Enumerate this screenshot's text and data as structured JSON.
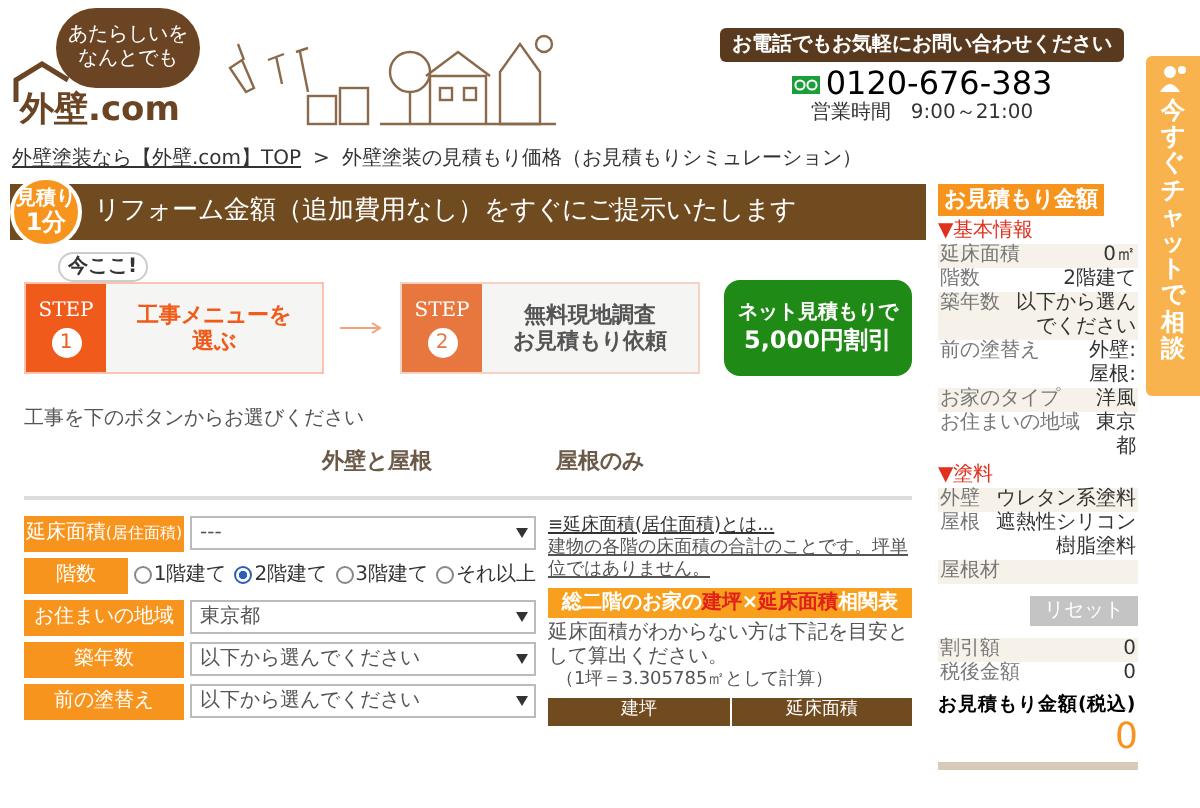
{
  "header": {
    "logo_bubble": [
      "あたらしいを",
      "なんとでも"
    ],
    "logo_text": "外壁.com",
    "contact_tagline": "お電話でもお気軽にお問い合わせください",
    "phone": "0120-676-383",
    "hours": "営業時間　9:00～21:00"
  },
  "chat_tab": {
    "label": "今すぐチャットで相談"
  },
  "breadcrumb": [
    {
      "label": "外壁塗装なら【外壁.com】TOP",
      "kind": "link"
    },
    {
      "label": ">",
      "kind": "separator"
    },
    {
      "label": "外壁塗装の見積もり価格（お見積もりシミュレーション）",
      "kind": "current"
    }
  ],
  "banner": {
    "badge": [
      "見積り",
      "1分"
    ],
    "title": "リフォーム金額（追加費用なし）をすぐにご提示いたします"
  },
  "steps": [
    {
      "step": "STEP",
      "number": "1",
      "lines": [
        "工事メニューを",
        "選ぶ"
      ],
      "selected": true,
      "bubble": "今ここ!"
    },
    {
      "step": "STEP",
      "number": "2",
      "lines": [
        "無料現地調査",
        "お見積もり依頼"
      ],
      "selected": false
    }
  ],
  "promo": [
    "ネット見積もりで",
    "5,000円割引"
  ],
  "instruction": "工事を下のボタンからお選びください",
  "choices": [
    "外壁と屋根",
    "屋根のみ"
  ],
  "form": [
    {
      "label": "延床面積",
      "sub": "(居住面積)",
      "kind": "select",
      "value": "---"
    },
    {
      "label": "階数",
      "kind": "radio",
      "options": [
        {
          "label": "1階建て",
          "selected": false
        },
        {
          "label": "2階建て",
          "selected": true
        },
        {
          "label": "3階建て",
          "selected": false
        },
        {
          "label": "それ以上",
          "selected": false
        }
      ]
    },
    {
      "label": "お住まいの地域",
      "kind": "select",
      "value": "東京都"
    },
    {
      "label": "築年数",
      "kind": "select",
      "value": "以下から選んでください"
    },
    {
      "label": "前の塗替え",
      "kind": "select",
      "value": "以下から選んでください"
    }
  ],
  "note": {
    "title": "≡延床面積(居住面積)とは...",
    "body": "建物の各階の床面積の合計のことです。坪単位ではありません。",
    "table_title": [
      {
        "text": "総二階のお家の",
        "highlight": false
      },
      {
        "text": "建坪",
        "highlight": true
      },
      {
        "text": "×",
        "highlight": false
      },
      {
        "text": "延床面積",
        "highlight": true
      },
      {
        "text": "相関表",
        "highlight": false
      }
    ],
    "explain": "延床面積がわからない方は下記を目安として算出ください。",
    "formula": "（1坪＝3.305785㎡として計算）",
    "columns": [
      "建坪",
      "延床面積"
    ]
  },
  "sidebar": {
    "title": "お見積もり金額",
    "sections": [
      {
        "heading": "▼基本情報",
        "rows": [
          {
            "label": "延床面積",
            "value": [
              "0㎡"
            ]
          },
          {
            "label": "階数",
            "value": [
              "2階建て"
            ]
          },
          {
            "label": "築年数",
            "value": [
              "以下から選んでください"
            ]
          },
          {
            "label": "前の塗替え",
            "value": [
              "外壁:",
              "屋根:"
            ]
          },
          {
            "label": "お家のタイプ",
            "value": [
              "洋風"
            ]
          },
          {
            "label": "お住まいの地域",
            "value": [
              "東京都"
            ]
          }
        ]
      },
      {
        "heading": "▼塗料",
        "rows": [
          {
            "label": "外壁",
            "value": [
              "ウレタン系塗料"
            ]
          },
          {
            "label": "屋根",
            "value": [
              "遮熱性シリコン樹脂塗料"
            ]
          },
          {
            "label": "屋根材",
            "value": []
          }
        ]
      }
    ],
    "reset": "リセット",
    "totals": [
      {
        "label": "割引額",
        "value": "0"
      },
      {
        "label": "税後金額",
        "value": "0"
      }
    ],
    "total_label": "お見積もり金額(税込)",
    "total": "0"
  }
}
